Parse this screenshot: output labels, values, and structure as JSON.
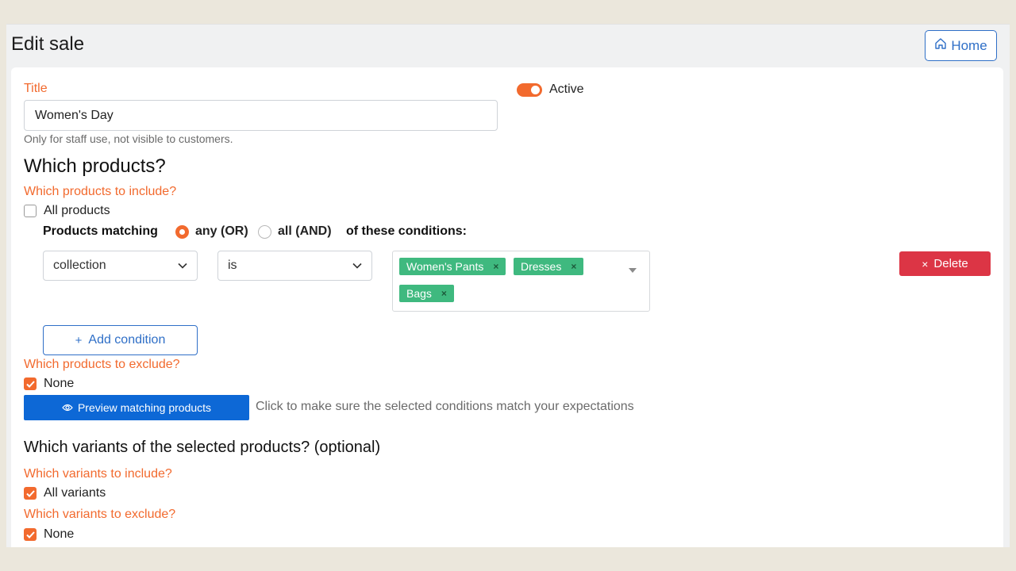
{
  "header": {
    "title": "Edit sale",
    "home_label": "Home"
  },
  "form": {
    "title_label": "Title",
    "title_value": "Women's Day",
    "title_help": "Only for staff use, not visible to customers.",
    "active_label": "Active",
    "active": true
  },
  "products": {
    "heading": "Which products?",
    "include_label": "Which products to include?",
    "all_products_label": "All products",
    "all_products_checked": false,
    "matching_label": "Products matching",
    "any_label": "any (OR)",
    "all_label": "all (AND)",
    "selected_mode": "any",
    "conditions_suffix": "of these conditions:",
    "condition": {
      "field": "collection",
      "operator": "is",
      "tags": [
        "Women's Pants",
        "Dresses",
        "Bags"
      ],
      "delete_label": "Delete"
    },
    "add_condition_label": "Add condition",
    "exclude_label": "Which products to exclude?",
    "exclude_none_label": "None",
    "exclude_none_checked": true,
    "preview_label": "Preview matching products",
    "preview_help": "Click to make sure the selected conditions match your expectations"
  },
  "variants": {
    "heading": "Which variants of the selected products? (optional)",
    "include_label": "Which variants to include?",
    "all_variants_label": "All variants",
    "all_variants_checked": true,
    "exclude_label": "Which variants to exclude?",
    "exclude_none_label": "None",
    "exclude_none_checked": true
  },
  "colors": {
    "accent": "#f26a2e",
    "primary": "#0d68d6",
    "link": "#2f6fc7",
    "danger": "#dc3545",
    "tag": "#3fb97f"
  }
}
